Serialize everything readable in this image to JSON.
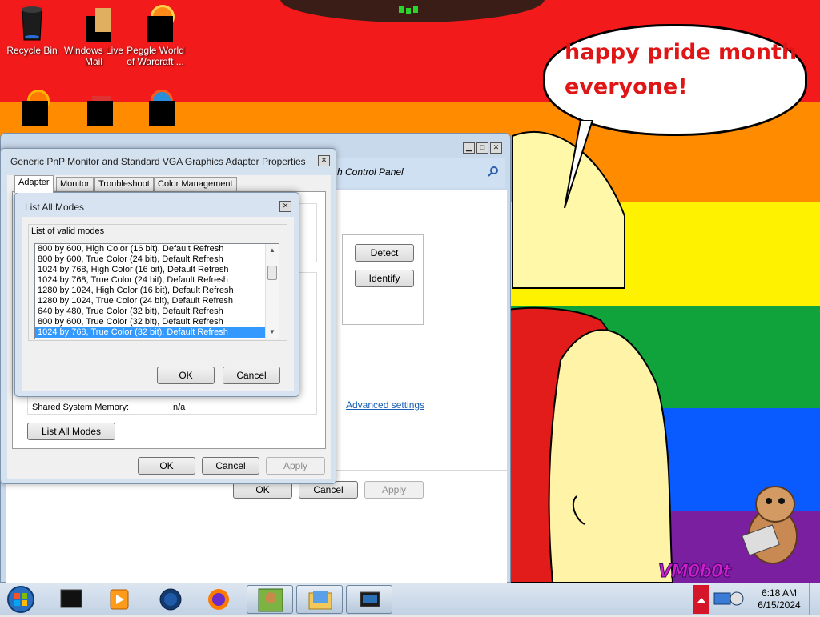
{
  "desktop": {
    "icons": [
      {
        "label": "Recycle Bin",
        "icon": "recycle-bin-icon"
      },
      {
        "label": "Windows Live Mail",
        "icon": "mail-icon"
      },
      {
        "label": "Peggle World of Warcraft ...",
        "icon": "peggle-icon"
      },
      {
        "label": "",
        "icon": "firefox-icon"
      },
      {
        "label": "",
        "icon": "app-icon"
      },
      {
        "label": "",
        "icon": "app-icon"
      }
    ],
    "wallpaper_colors": [
      "#f21a1a",
      "#ff8c00",
      "#fff200",
      "#10a33b",
      "#0a5bff",
      "#7a1fa0"
    ],
    "speech_bubble": {
      "line1": "happy pride month",
      "line2": "everyone!"
    },
    "watermark": "VM0b0t"
  },
  "control_panel": {
    "address_text": "h Control Panel",
    "buttons": {
      "detect": "Detect",
      "identify": "Identify",
      "ok": "OK",
      "cancel": "Cancel",
      "apply": "Apply"
    },
    "advanced_link": "Advanced settings"
  },
  "properties_dialog": {
    "title": "Generic PnP Monitor and Standard VGA Graphics Adapter Properties",
    "tabs": [
      "Adapter",
      "Monitor",
      "Troubleshoot",
      "Color Management"
    ],
    "active_tab": "Adapter",
    "shared_memory_label": "Shared System Memory:",
    "shared_memory_value": "n/a",
    "list_all_modes_button": "List All Modes",
    "buttons": {
      "ok": "OK",
      "cancel": "Cancel",
      "apply": "Apply"
    }
  },
  "modes_dialog": {
    "title": "List All Modes",
    "group_label": "List of valid modes",
    "modes": [
      "800 by 600, High Color (16 bit), Default Refresh",
      "800 by 600, True Color (24 bit), Default Refresh",
      "1024 by 768, High Color (16 bit), Default Refresh",
      "1024 by 768, True Color (24 bit), Default Refresh",
      "1280 by 1024, High Color (16 bit), Default Refresh",
      "1280 by 1024, True Color (24 bit), Default Refresh",
      "640 by 480, True Color (32 bit), Default Refresh",
      "800 by 600, True Color (32 bit), Default Refresh",
      "1024 by 768, True Color (32 bit), Default Refresh"
    ],
    "selected_index": 8,
    "ok": "OK",
    "cancel": "Cancel"
  },
  "taskbar": {
    "start": "start-orb-icon",
    "items": [
      "terminal-icon",
      "media-player-icon",
      "globe-icon",
      "firefox-icon",
      "box-game-icon",
      "folder-icon",
      "display-settings-icon"
    ],
    "time": "6:18 AM",
    "date": "6/15/2024"
  }
}
